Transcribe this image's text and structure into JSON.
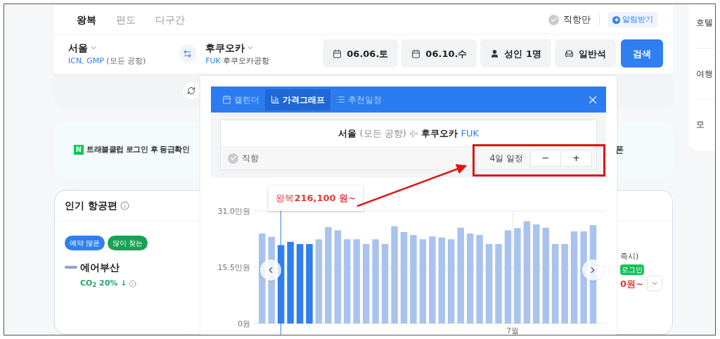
{
  "trip_tabs": [
    {
      "label": "왕복",
      "selected": true
    },
    {
      "label": "편도",
      "selected": false
    },
    {
      "label": "다구간",
      "selected": false
    }
  ],
  "direct_only": {
    "label": "직항만",
    "checked": false
  },
  "alert_button": "알림받기",
  "origin": {
    "city": "서울",
    "codes": "ICN, GMP",
    "airport": "(모든 공항)"
  },
  "destination": {
    "city": "후쿠오카",
    "codes": "FUK",
    "airport": "후쿠오카공항"
  },
  "search_fields": [
    {
      "kind": "date",
      "label": "06.06.토"
    },
    {
      "kind": "date",
      "label": "06.10.수"
    },
    {
      "kind": "passenger",
      "label": "성인 1명"
    },
    {
      "kind": "cabin",
      "label": "일반석"
    }
  ],
  "search_button": "검색",
  "banner": {
    "logo": "N",
    "text": "트래블클럽 로그인 후 등급확인",
    "right_text": "폰"
  },
  "popular": {
    "title": "인기 항공편",
    "tags": [
      {
        "label": "예약 많은",
        "color": "#2f7ff0"
      },
      {
        "label": "많이 찾는",
        "color": "#14a352"
      }
    ],
    "airline": "에어부산",
    "co2": "CO$_{2}$ 20% ↓",
    "note": "족시)",
    "login_badge": "로그인",
    "price": "0원~"
  },
  "side_menu": [
    "호텔",
    "여행",
    "모"
  ],
  "price_popup": {
    "tabs": [
      {
        "label": "캘린더",
        "kind": "calendar",
        "selected": false
      },
      {
        "label": "가격그래프",
        "kind": "graph",
        "selected": true
      },
      {
        "label": "추천일정",
        "kind": "list",
        "selected": false
      }
    ],
    "route": {
      "from_city": "서울",
      "from_airport": "(모든 공항)",
      "to_city": "후쿠오카",
      "to_code": "FUK"
    },
    "direct": {
      "label": "직항",
      "checked": false
    },
    "trip_length": "4일 일정",
    "decrease": "−",
    "increase": "+",
    "tooltip": "왕복**216,100 원~**",
    "chart_data": {
      "type": "bar",
      "ylim": [
        0,
        31
      ],
      "yticks": [
        {
          "value": 0,
          "label": "0원"
        },
        {
          "value": 15.5,
          "label": "15.5만원"
        },
        {
          "value": 31,
          "label": "31.0만원"
        }
      ],
      "annotations": [
        "7월"
      ],
      "stacked": true,
      "series": [
        {
          "color": "#a9c3ee",
          "values": [
            24.8,
            23.9,
            null,
            null,
            null,
            null,
            23.2,
            26.6,
            25.7,
            23.2,
            23.2,
            21.9,
            23.2,
            21.9,
            26.8,
            25.2,
            24.4,
            23.2,
            24.0,
            23.7,
            23.2,
            26.4,
            24.8,
            24.4,
            21.9,
            21.9,
            25.7,
            26.3,
            28.2,
            27.3,
            26.4,
            21.9,
            21.9,
            25.4,
            25.4,
            27.1
          ]
        },
        {
          "color": "#2f7ff0",
          "values": [
            null,
            null,
            21.6,
            22.5,
            21.9,
            21.9,
            null,
            null,
            null,
            null,
            null,
            null,
            null,
            null,
            null,
            null,
            null,
            null,
            null,
            null,
            null,
            null,
            null,
            null,
            null,
            null,
            null,
            null,
            null,
            null,
            null,
            null,
            null,
            null,
            null,
            null
          ]
        }
      ]
    }
  }
}
